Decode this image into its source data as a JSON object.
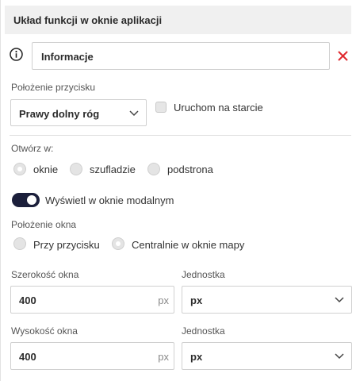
{
  "header": {
    "title": "Układ funkcji w oknie aplikacji"
  },
  "name_field": {
    "value": "Informacje"
  },
  "button_position": {
    "label": "Położenie przycisku",
    "selected": "Prawy dolny róg"
  },
  "startup_checkbox": {
    "label": "Uruchom na starcie",
    "checked": false
  },
  "open_in": {
    "label": "Otwórz w:",
    "options": [
      "oknie",
      "szufladzie",
      "podstrona"
    ],
    "selected": "oknie"
  },
  "modal_toggle": {
    "label": "Wyświetl w oknie modalnym",
    "on": true
  },
  "window_position": {
    "label": "Położenie okna",
    "options": [
      "Przy przycisku",
      "Centralnie w oknie mapy"
    ],
    "selected": "Centralnie w oknie mapy"
  },
  "width": {
    "label": "Szerokość okna",
    "value": "400",
    "suffix": "px",
    "unit_label": "Jednostka",
    "unit": "px"
  },
  "height": {
    "label": "Wysokość okna",
    "value": "400",
    "suffix": "px",
    "unit_label": "Jednostka",
    "unit": "px"
  },
  "colors": {
    "accent": "#1b1f3b",
    "danger": "#e0282e",
    "header_bg": "#f0f0f0"
  }
}
